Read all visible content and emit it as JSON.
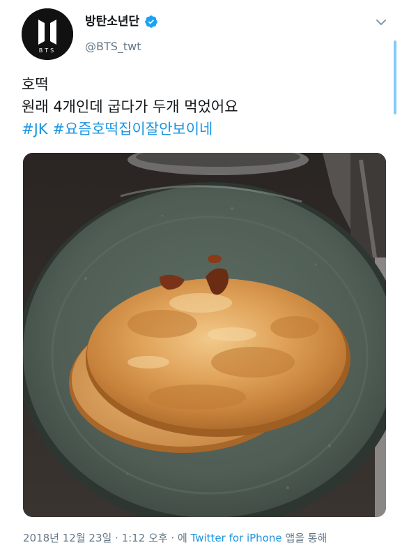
{
  "author": {
    "display_name": "방탄소년단",
    "handle": "@BTS_twt",
    "verified": true,
    "avatar_icon": "bts-logo-icon",
    "avatar_text": "BTS"
  },
  "tweet": {
    "line1": "호떡",
    "line2": "원래 4개인데 굽다가 두개 먹었어요",
    "hashtags": [
      "#JK",
      "#요즘호떡집이잘안보이네"
    ]
  },
  "media": {
    "description_icon": "photo-hotteok-on-plate"
  },
  "meta": {
    "timestamp": "2018년 12월 23일 · 1:12 오후 · 에",
    "source": "Twitter for iPhone",
    "suffix": "앱을 통해"
  },
  "colors": {
    "link": "#1b95e0",
    "verified": "#1da1f2",
    "secondary_text": "#657786"
  }
}
